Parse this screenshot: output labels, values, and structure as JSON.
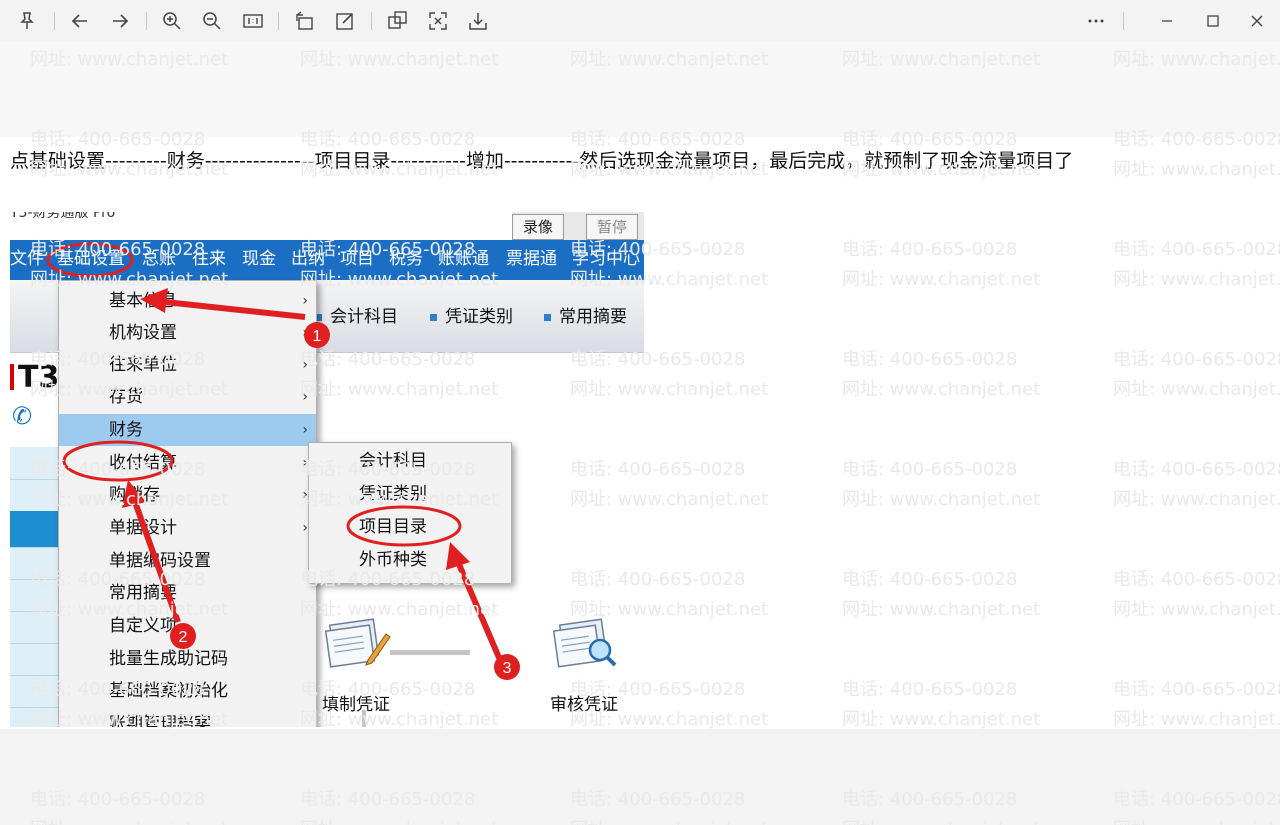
{
  "caption": "点基础设置---------财务----------------项目目录-----------增加-----------然后选现金流量项目，最后完成，就预制了现金流量项目了",
  "watermark": {
    "phone": "电话: 400-665-0028",
    "site": "网址: www.chanjet.net"
  },
  "screenshot": {
    "app_title": "T3-财务通版 Pro",
    "top_buttons": [
      "录像",
      "暂停"
    ],
    "menubar": [
      "文件",
      "基础设置",
      "总账",
      "往来",
      "现金",
      "出纳",
      "项目",
      "税务",
      "账账通",
      "票据通",
      "学习中心"
    ],
    "toolbar_items": [
      "会计科目",
      "凭证类别",
      "常用摘要"
    ],
    "logo": "T3",
    "dropdown": [
      {
        "label": "基本信息",
        "arrow": "›"
      },
      {
        "label": "机构设置",
        "arrow": "›"
      },
      {
        "label": "往来单位",
        "arrow": "›"
      },
      {
        "label": "存货",
        "arrow": "›"
      },
      {
        "label": "财务",
        "arrow": "›"
      },
      {
        "label": "收付结算",
        "arrow": "›"
      },
      {
        "label": "购销存",
        "arrow": "›"
      },
      {
        "label": "单据设计",
        "arrow": "›"
      },
      {
        "label": "单据编码设置",
        "arrow": ""
      },
      {
        "label": "常用摘要",
        "arrow": ""
      },
      {
        "label": "自定义项",
        "arrow": ""
      },
      {
        "label": "批量生成助记码",
        "arrow": ""
      },
      {
        "label": "基础档案初始化",
        "arrow": ""
      },
      {
        "label": "账期管理档案",
        "arrow": ""
      }
    ],
    "submenu": [
      "会计科目",
      "凭证类别",
      "项目目录",
      "外币种类"
    ],
    "flow": {
      "fill_voucher": "填制凭证",
      "audit_voucher": "审核凭证"
    },
    "markers": [
      "1",
      "2",
      "3"
    ],
    "annotation_color": "#e02020"
  }
}
